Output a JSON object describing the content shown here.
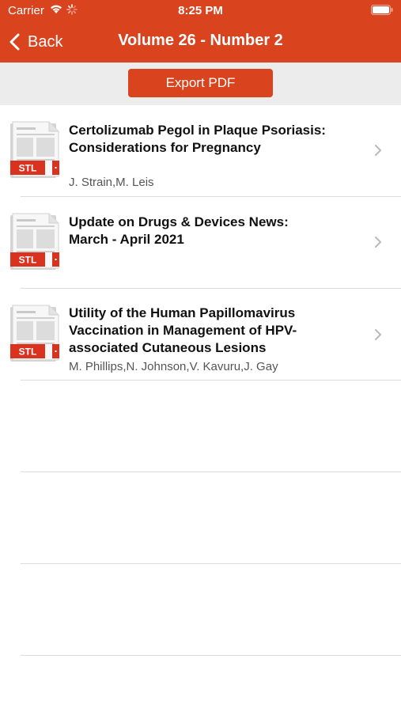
{
  "status_bar": {
    "carrier": "Carrier",
    "time": "8:25 PM"
  },
  "nav": {
    "back_label": "Back",
    "title": "Volume 26 - Number 2"
  },
  "toolbar": {
    "export_label": "Export PDF"
  },
  "articles": [
    {
      "title_line1": "Certolizumab Pegol in Plaque Psoriasis:",
      "title_line2": "Considerations for Pregnancy",
      "title_line3": "",
      "authors": "J. Strain,M. Leis",
      "badge": "STL"
    },
    {
      "title_line1": "Update on Drugs & Devices News:",
      "title_line2": "March - April 2021",
      "title_line3": "",
      "authors": "",
      "badge": "STL"
    },
    {
      "title_line1": "Utility of the Human Papillomavirus",
      "title_line2": "Vaccination in Management of HPV-",
      "title_line3": "associated Cutaneous Lesions",
      "authors": "M. Phillips,N. Johnson,V. Kavuru,J. Gay",
      "badge": "STL"
    }
  ],
  "colors": {
    "accent": "#d9441f",
    "toolbar_bg": "#ececec"
  }
}
